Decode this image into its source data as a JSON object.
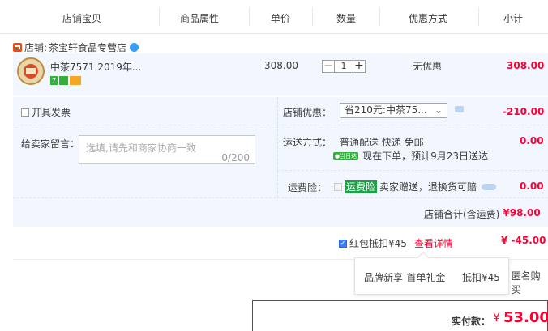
{
  "header": {
    "col_item": "店铺宝贝",
    "col_attr": "商品属性",
    "col_price": "单价",
    "col_qty": "数量",
    "col_promo": "优惠方式",
    "col_subtotal": "小计"
  },
  "shop": {
    "prefix": "店铺:",
    "name": "茶宝轩食品专营店"
  },
  "item": {
    "title": "中茶7571 2019年...",
    "price": "308.00",
    "quantity": "1",
    "minus": "−",
    "plus": "+",
    "promo": "无优惠",
    "subtotal": "308.00",
    "tag_1": "7"
  },
  "invoice": {
    "label": "开具发票"
  },
  "message": {
    "label": "给卖家留言：",
    "placeholder": "选填,请先和商家协商一致",
    "counter": "0/200"
  },
  "shop_discount": {
    "label": "店铺优惠：",
    "selected": "省210元:中茶75...",
    "amount": "-210.00"
  },
  "shipping": {
    "label": "运送方式：",
    "method": "普通配送 快递 免邮",
    "badge": "●当日达",
    "estimate": "现在下单，预计9月23日送达",
    "amount": "0.00"
  },
  "insurance": {
    "label": "运费险：",
    "badge": "运费险",
    "text": "卖家赠送，退换货可赔",
    "amount": "0.00"
  },
  "shop_total": {
    "label": "店铺合计(含运费)",
    "amount": "¥98.00"
  },
  "red_packet": {
    "label": "红包抵扣¥45",
    "link": "查看详情",
    "amount": "¥ -45.00"
  },
  "popup": {
    "name": "品牌新享-首单礼金",
    "value": "抵扣¥45"
  },
  "anonymous": {
    "label": "匿名购买"
  },
  "payment": {
    "label": "实付款：",
    "currency": "¥",
    "amount": "53.00"
  },
  "colors": {
    "accent": "#ff0036",
    "panel": "#f2f7ff",
    "link": "#3d7ff5",
    "green_badge": "#31b13a"
  }
}
